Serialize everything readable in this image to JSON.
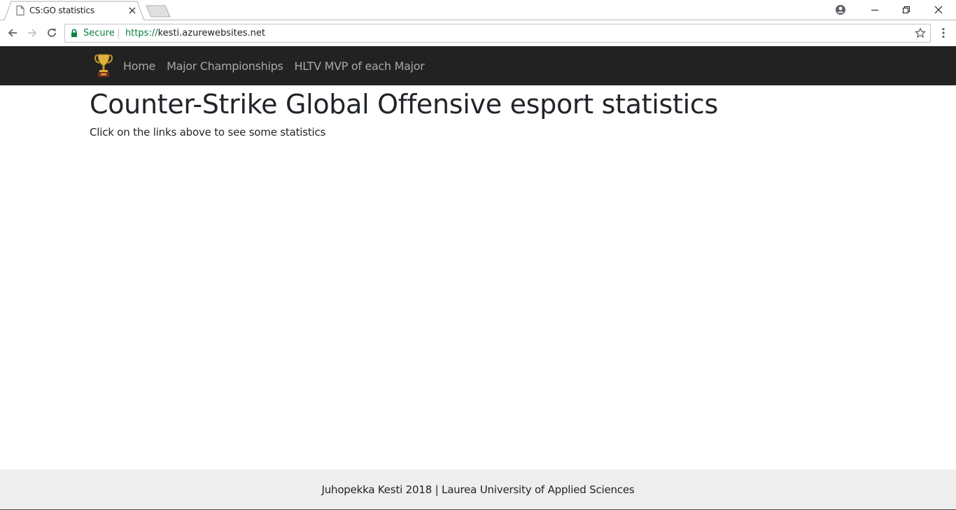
{
  "browser": {
    "tab": {
      "title": "CS:GO statistics",
      "favicon": "page-icon"
    },
    "omnibox": {
      "security_label": "Secure",
      "url_scheme": "https://",
      "url_host": "kesti.azurewebsites.net"
    },
    "icons": {
      "back": "back-arrow-icon",
      "forward": "forward-arrow-icon",
      "reload": "reload-icon",
      "bookmark": "star-icon",
      "menu": "kebab-menu-icon",
      "profile": "profile-icon",
      "minimize": "minimize-icon",
      "restore": "restore-icon",
      "close": "close-icon"
    }
  },
  "navbar": {
    "brand_icon": "trophy-icon",
    "links": [
      "Home",
      "Major Championships",
      "HLTV MVP of each Major"
    ]
  },
  "main": {
    "heading": "Counter-Strike Global Offensive esport statistics",
    "subtext": "Click on the links above to see some statistics"
  },
  "footer": {
    "text": "Juhopekka Kesti 2018 | Laurea University of Applied Sciences"
  },
  "colors": {
    "navbar_bg": "#222222",
    "nav_link": "#a8a8a8",
    "secure_green": "#0b8043",
    "footer_bg": "#eeeeee",
    "text": "#212529"
  }
}
